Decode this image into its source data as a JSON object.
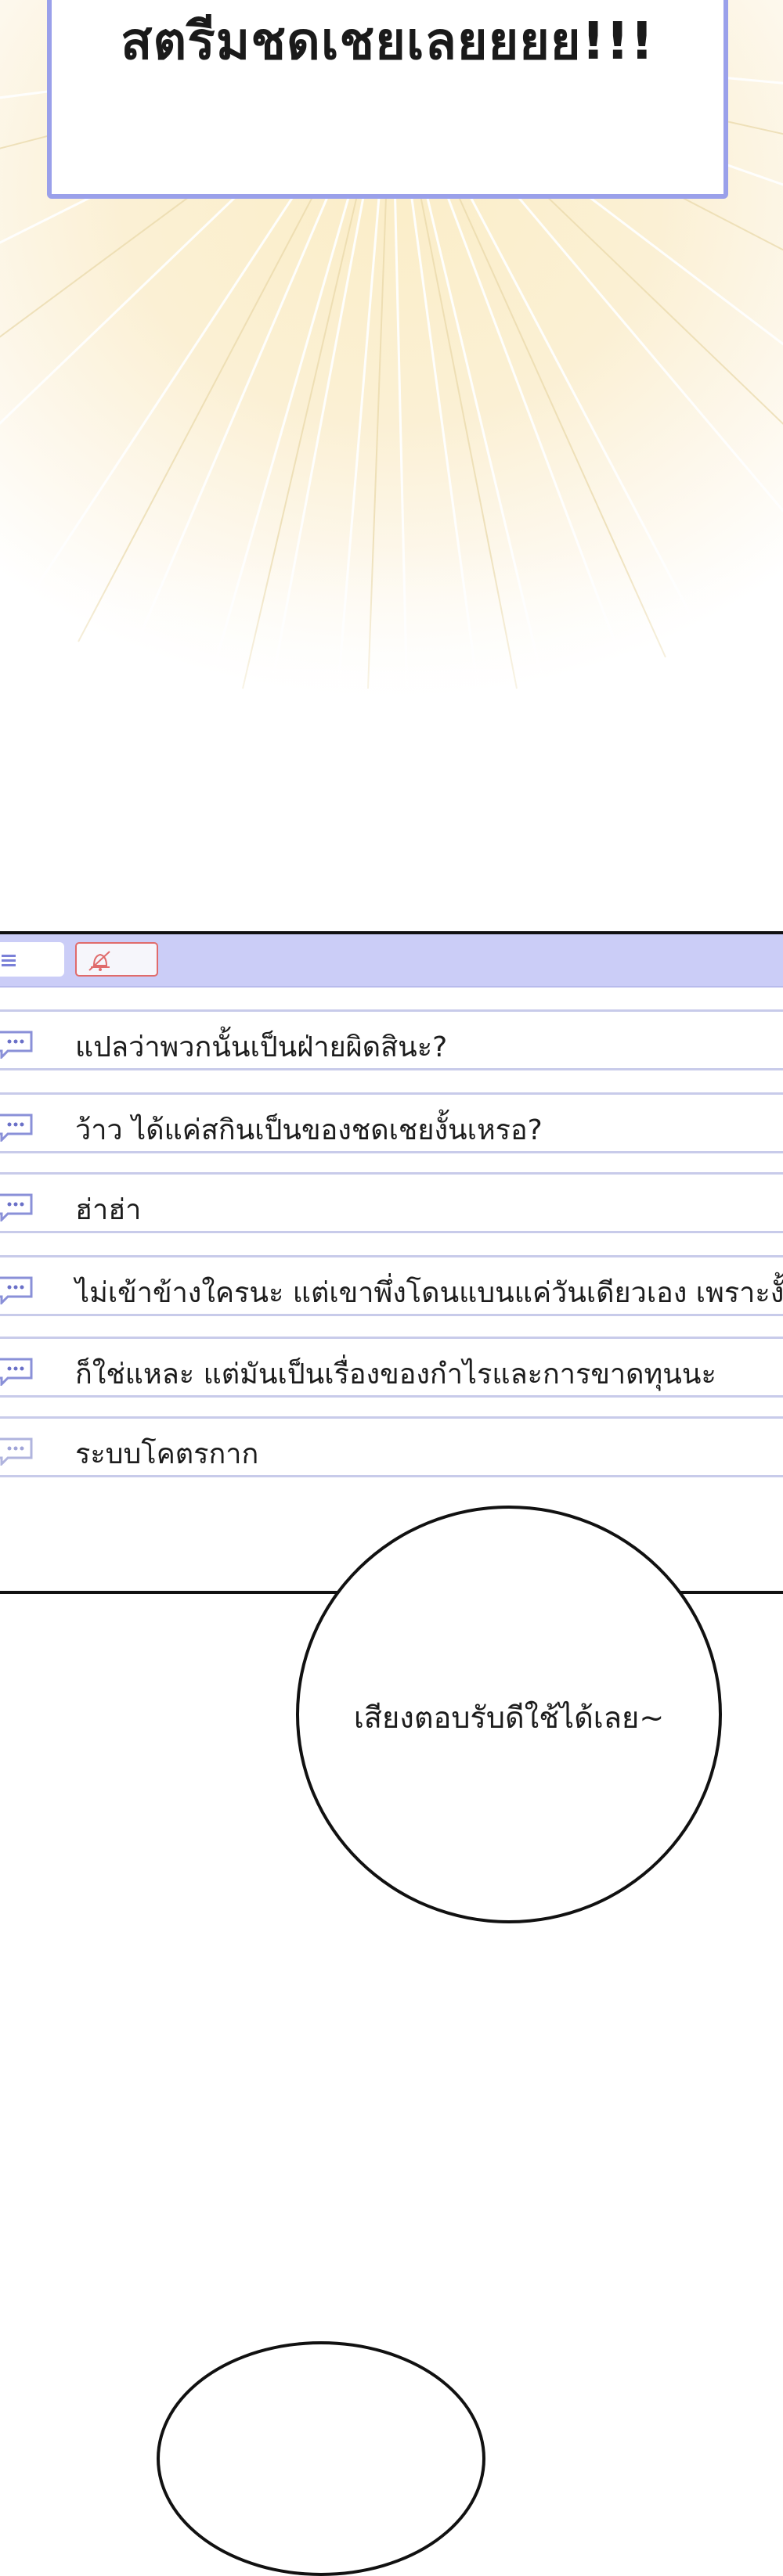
{
  "shout": {
    "text": "สตรีมชดเชยเลยยยย!!!"
  },
  "chat": {
    "messages": [
      {
        "text": "แปลว่าพวกนั้นเป็นฝ่ายผิดสินะ?"
      },
      {
        "text": "ว้าว ได้แค่สกินเป็นของชดเชยงั้นเหรอ?"
      },
      {
        "text": "ฮ่าฮ่า"
      },
      {
        "text": "ไม่เข้าข้างใครนะ แต่เขาพึ่งโดนแบนแค่วันเดียวเอง เพราะงั้"
      },
      {
        "text": "ก็ใช่แหละ แต่มันเป็นเรื่องของกำไรและการขาดทุนนะ"
      },
      {
        "text": "ระบบโคตรกาก"
      }
    ]
  },
  "speech": {
    "text": "เสียงตอบรับดีใช้ได้เลย~"
  },
  "colors": {
    "frame": "#9aa0ea",
    "chat_header": "#cbcdf7",
    "mute_border": "#e06b6b",
    "divider": "#c8cbea"
  },
  "icons": {
    "menu": "menu-icon",
    "mute": "bell-off-icon",
    "message": "chat-bubble-icon"
  }
}
